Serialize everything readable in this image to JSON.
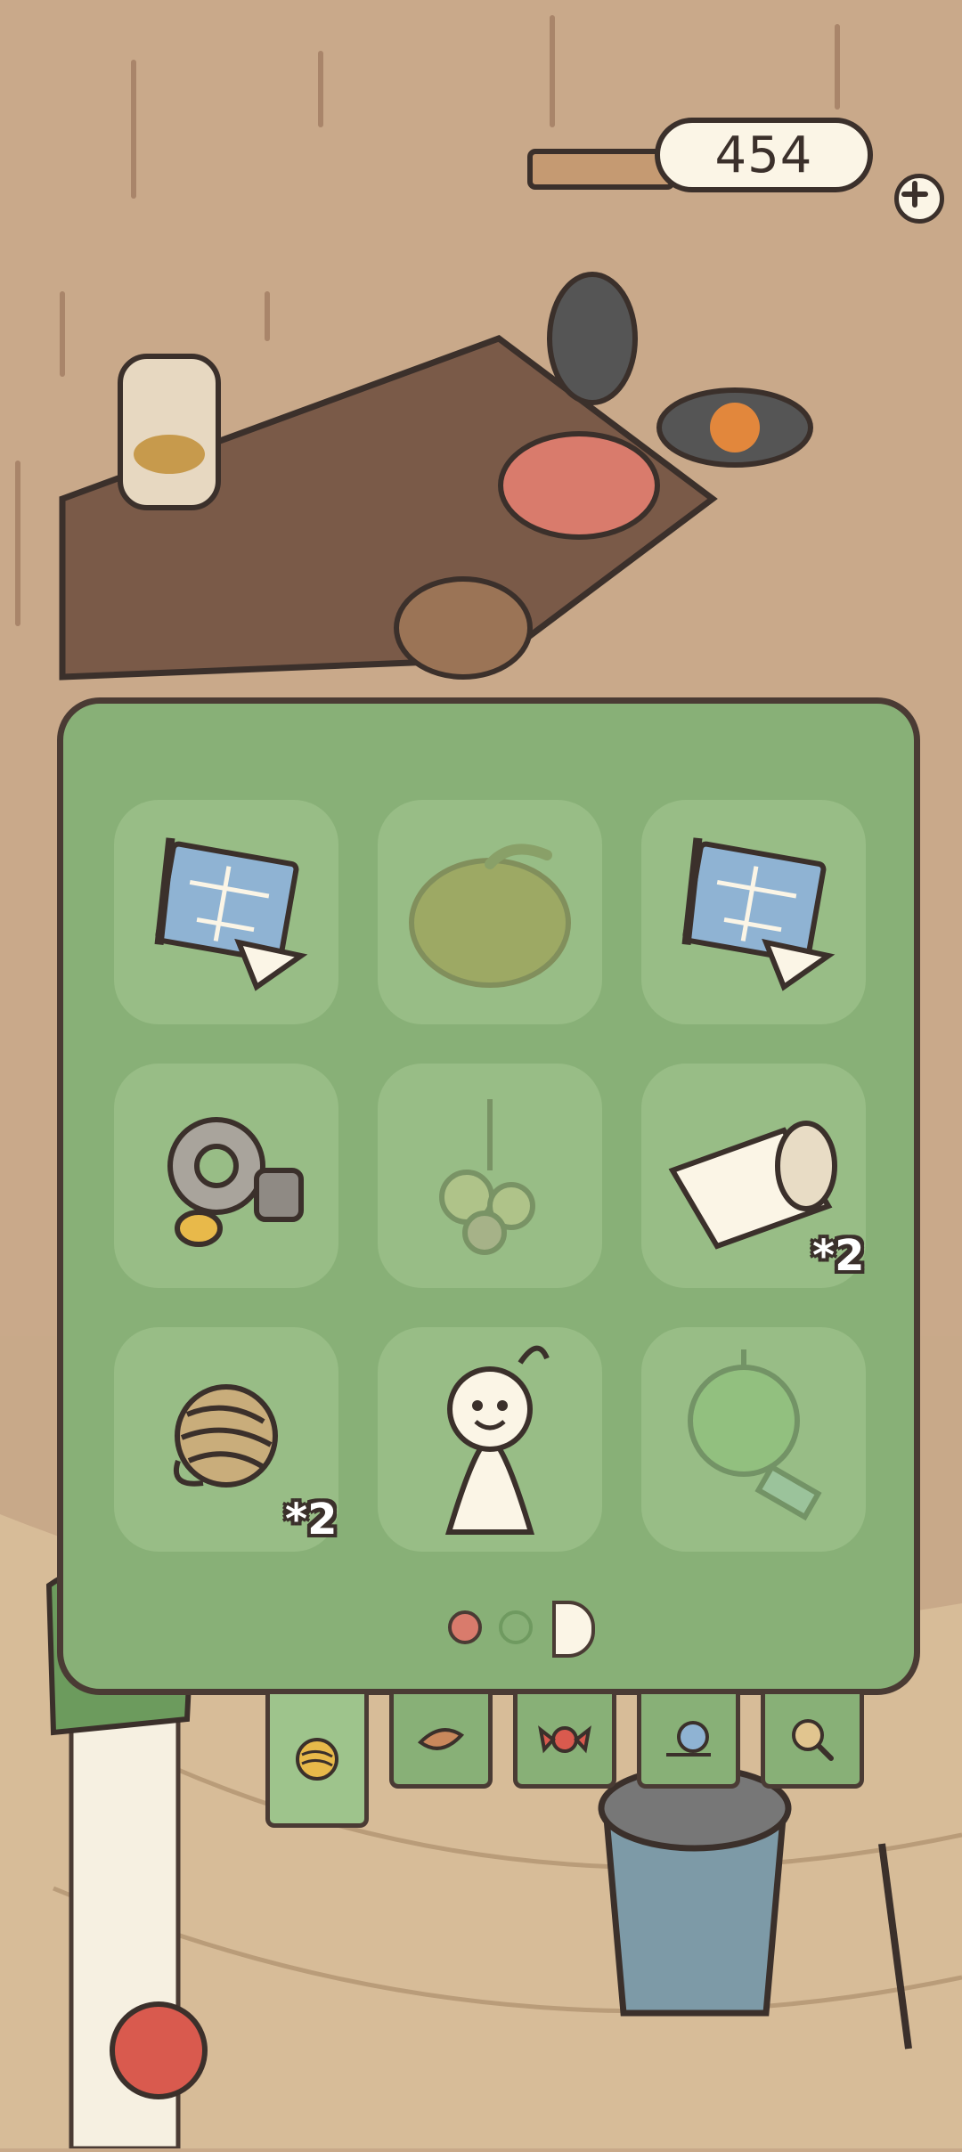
{
  "hud": {
    "currency": "454",
    "add_icon": "plus-icon"
  },
  "inventory": {
    "page_dots": [
      {
        "state": "active",
        "color": "#d97b6c"
      },
      {
        "state": "inactive",
        "color": "#88b077"
      },
      {
        "state": "half",
        "color": "#fbf5e6"
      }
    ],
    "slots": [
      {
        "icon": "blueprint-icon",
        "count": "",
        "locked": false
      },
      {
        "icon": "pumpkin-icon",
        "count": "",
        "locked": true
      },
      {
        "icon": "blueprint-icon",
        "count": "",
        "locked": false
      },
      {
        "icon": "gear-icon",
        "count": "",
        "locked": false
      },
      {
        "icon": "herb-bundle-icon",
        "count": "",
        "locked": true
      },
      {
        "icon": "paper-scroll-icon",
        "count": "*2",
        "locked": false
      },
      {
        "icon": "yarn-ball-icon",
        "count": "*2",
        "locked": false
      },
      {
        "icon": "teru-teru-bozu-icon",
        "count": "",
        "locked": false
      },
      {
        "icon": "wind-chime-icon",
        "count": "",
        "locked": true
      }
    ]
  },
  "tabs": [
    {
      "icon": "yarn-ball-icon",
      "active": true
    },
    {
      "icon": "leaf-icon",
      "active": false
    },
    {
      "icon": "candy-icon",
      "active": false
    },
    {
      "icon": "snail-icon",
      "active": false
    },
    {
      "icon": "magnifier-icon",
      "active": false
    }
  ]
}
